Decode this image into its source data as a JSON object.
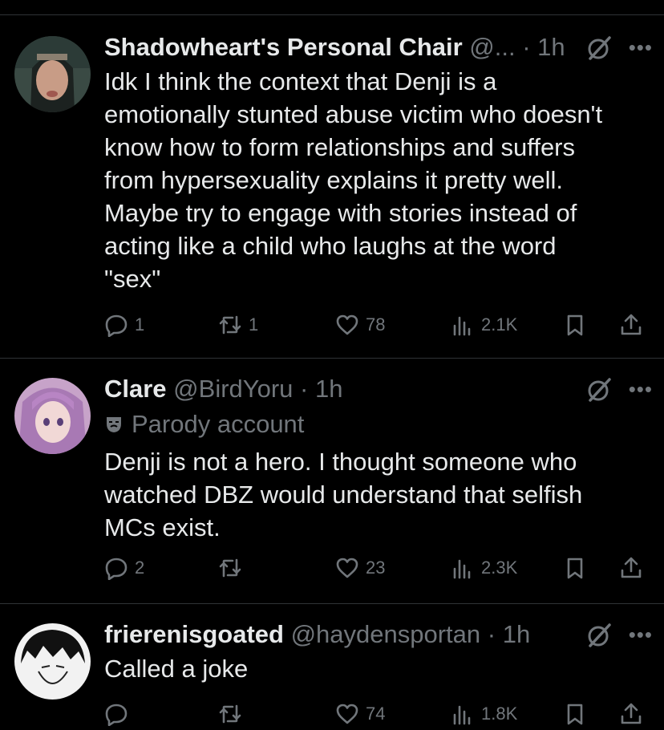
{
  "tweets": [
    {
      "name": "Shadowheart's Personal Chair",
      "handle": "@...",
      "time": "1h",
      "text": "Idk I think the context that Denji is a\nemotionally stunted abuse victim who doesn't\nknow how to form relationships and suffers\nfrom hypersexuality explains it pretty well.\nMaybe try to engage with stories instead of\nacting like a child who laughs at the word\n\"sex\"",
      "replies": "1",
      "reposts": "1",
      "likes": "78",
      "views": "2.1K"
    },
    {
      "name": "Clare",
      "handle": "@BirdYoru",
      "time": "1h",
      "badge": "Parody account",
      "text": "Denji is not a hero. I thought someone who\nwatched DBZ would understand that selfish\nMCs exist.",
      "replies": "2",
      "reposts": "",
      "likes": "23",
      "views": "2.3K"
    },
    {
      "name": "frierenisgoated",
      "handle": "@haydensportan",
      "time": "1h",
      "text": "Called a joke",
      "replies": "",
      "reposts": "",
      "likes": "74",
      "views": "1.8K"
    }
  ],
  "icons": {
    "reply": "reply-icon",
    "repost": "repost-icon",
    "like": "heart-icon",
    "views": "views-icon",
    "bookmark": "bookmark-icon",
    "share": "share-icon",
    "grok": "grok-icon",
    "more": "more-icon"
  },
  "colors": {
    "background": "#000000",
    "text": "#e7e9ea",
    "muted": "#71767b",
    "divider": "#2f3336"
  }
}
